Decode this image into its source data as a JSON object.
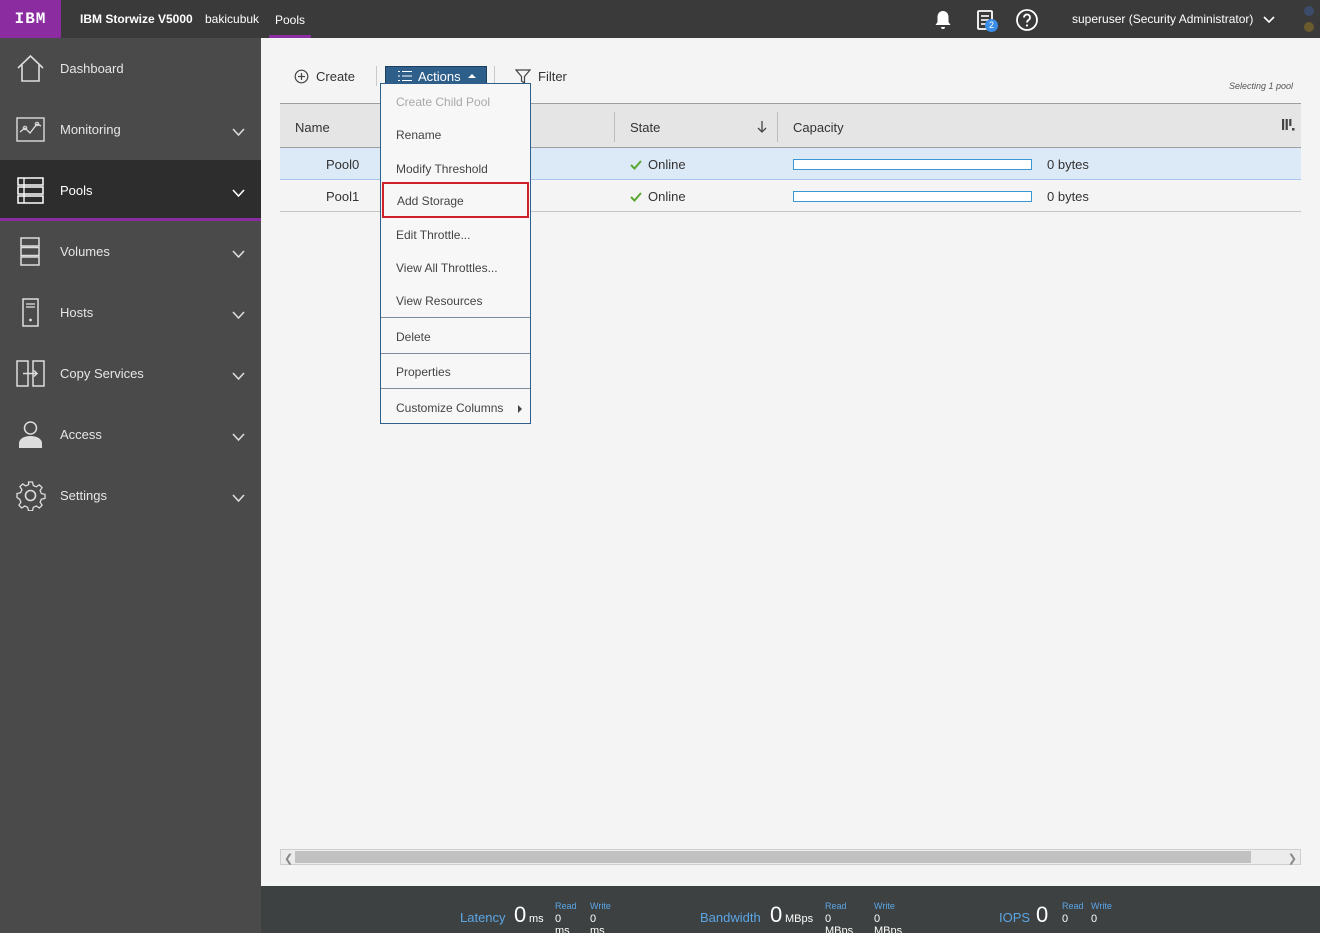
{
  "header": {
    "logo": "IBM",
    "product": "IBM Storwize V5000",
    "system_name": "bakicubuk",
    "breadcrumb": "Pools",
    "notification_badge": "2",
    "user": "superuser (Security Administrator)"
  },
  "sidebar": {
    "items": [
      {
        "label": "Dashboard",
        "icon": "dashboard-icon"
      },
      {
        "label": "Monitoring",
        "icon": "monitoring-icon"
      },
      {
        "label": "Pools",
        "icon": "pools-icon",
        "active": true
      },
      {
        "label": "Volumes",
        "icon": "volumes-icon"
      },
      {
        "label": "Hosts",
        "icon": "hosts-icon"
      },
      {
        "label": "Copy Services",
        "icon": "copy-services-icon"
      },
      {
        "label": "Access",
        "icon": "access-icon"
      },
      {
        "label": "Settings",
        "icon": "settings-icon"
      }
    ]
  },
  "toolbar": {
    "create_label": "Create",
    "actions_label": "Actions",
    "filter_label": "Filter",
    "selecting_text": "Selecting 1 pool"
  },
  "table": {
    "columns": [
      "Name",
      "State",
      "Capacity"
    ],
    "rows": [
      {
        "name": "Pool0",
        "state": "Online",
        "capacity": "0 bytes",
        "selected": true,
        "used_fraction": 0
      },
      {
        "name": "Pool1",
        "state": "Online",
        "capacity": "0 bytes",
        "selected": false,
        "used_fraction": 0
      }
    ]
  },
  "actions_menu": {
    "items": [
      {
        "label": "Create Child Pool",
        "disabled": true
      },
      {
        "label": "Rename"
      },
      {
        "label": "Modify Threshold"
      },
      {
        "label": "Add Storage",
        "highlighted": true
      },
      {
        "label": "Edit Throttle..."
      },
      {
        "label": "View All Throttles..."
      },
      {
        "label": "View Resources"
      },
      {
        "label": "Delete"
      },
      {
        "label": "Properties"
      },
      {
        "label": "Customize Columns",
        "has_submenu": true
      }
    ]
  },
  "status_bar": {
    "latency": {
      "label": "Latency",
      "value": "0",
      "unit": "ms",
      "read_label": "Read",
      "read_value": "0 ms",
      "write_label": "Write",
      "write_value": "0 ms"
    },
    "bandwidth": {
      "label": "Bandwidth",
      "value": "0",
      "unit": "MBps",
      "read_label": "Read",
      "read_value": "0 MBps",
      "write_label": "Write",
      "write_value": "0 MBps"
    },
    "iops": {
      "label": "IOPS",
      "value": "0",
      "read_label": "Read",
      "read_value": "0",
      "write_label": "Write",
      "write_value": "0"
    }
  },
  "colors": {
    "brand": "#8b2da0",
    "topbar": "#3a3a3a",
    "sidebar": "#4a4a4a",
    "actions_button": "#2e5f8a",
    "highlight_border": "#d0202a",
    "online_check": "#5aa832",
    "capacity_bar": "#3b97d3",
    "selected_row": "#dce9f7"
  }
}
